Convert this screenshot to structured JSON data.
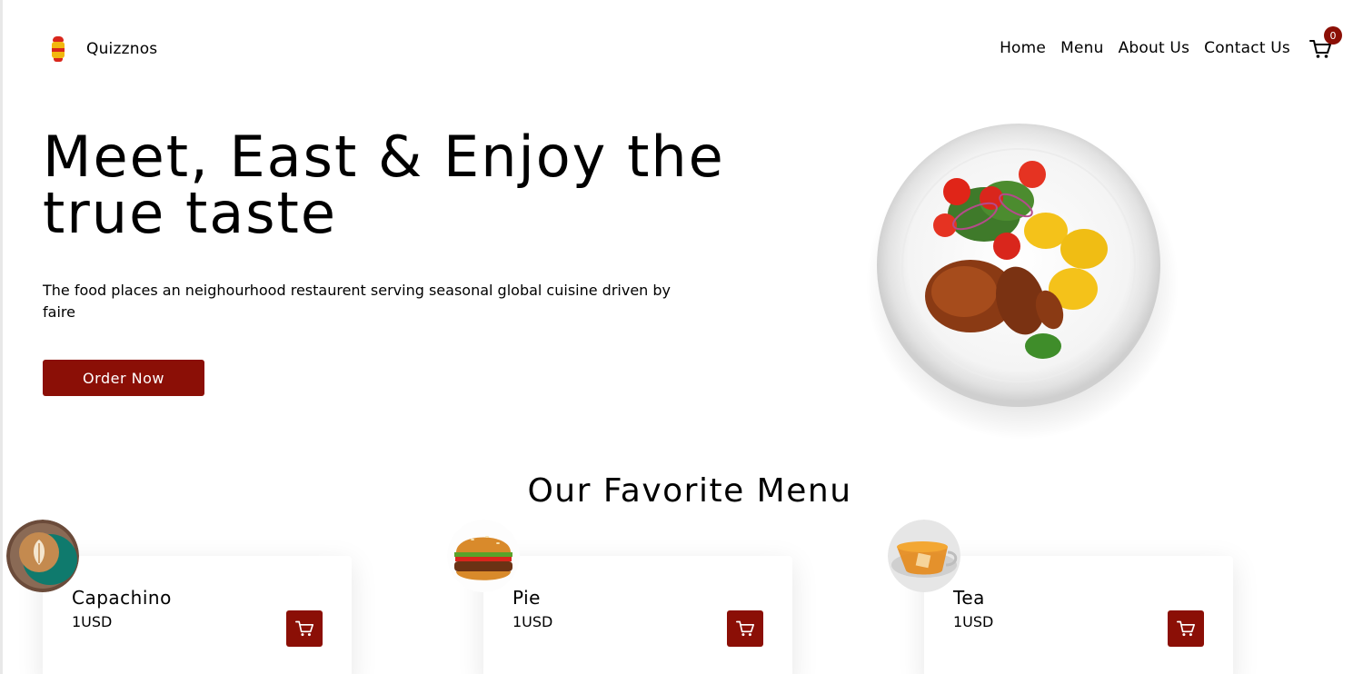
{
  "header": {
    "brand": "Quizznos",
    "nav": [
      "Home",
      "Menu",
      "About Us",
      "Contact Us"
    ],
    "cart_count": "0"
  },
  "hero": {
    "title_line1": "Meet, East & Enjoy the",
    "title_line2": "true taste",
    "description": "The food places an neighourhood restaurent serving seasonal global cuisine driven by faire",
    "cta": "Order Now"
  },
  "menu": {
    "title": "Our Favorite Menu",
    "items": [
      {
        "name": "Capachino",
        "price": "1USD",
        "icon": "coffee-cup"
      },
      {
        "name": "Pie",
        "price": "1USD",
        "icon": "burger"
      },
      {
        "name": "Tea",
        "price": "1USD",
        "icon": "tea-cup"
      }
    ]
  },
  "colors": {
    "accent": "#8b0f06",
    "text": "#000000",
    "background": "#ffffff"
  }
}
